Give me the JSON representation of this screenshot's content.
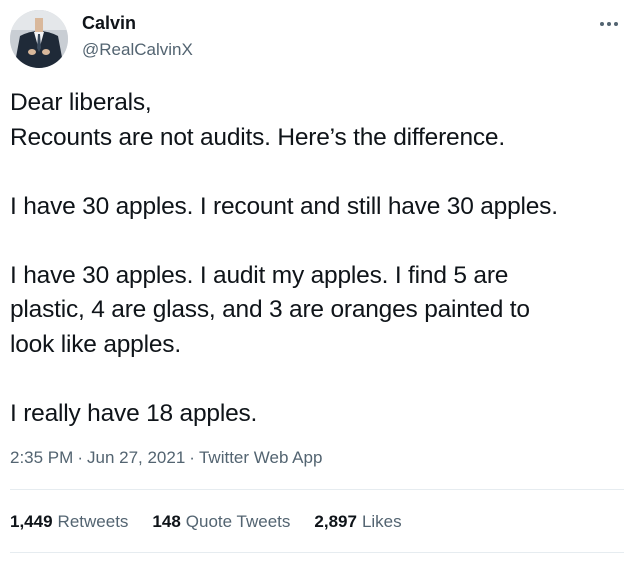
{
  "author": {
    "name": "Calvin",
    "handle": "@RealCalvinX"
  },
  "tweet": {
    "paragraphs": [
      [
        "Dear liberals,",
        "Recounts are not audits. Here’s the difference."
      ],
      [
        "I have 30 apples. I recount and still have 30 apples."
      ],
      [
        "I have 30 apples. I audit my apples. I find 5 are",
        "plastic, 4 are glass, and 3 are oranges painted to",
        "look like apples."
      ],
      [
        "I really have 18 apples."
      ]
    ],
    "time": "2:35 PM",
    "date": "Jun 27, 2021",
    "source": "Twitter Web App",
    "separator": "·"
  },
  "stats": {
    "retweets_count": "1,449",
    "retweets_label": "Retweets",
    "quotes_count": "148",
    "quotes_label": "Quote Tweets",
    "likes_count": "2,897",
    "likes_label": "Likes"
  },
  "icons": {
    "more": "more-horizontal-icon"
  },
  "colors": {
    "text": "#0f1419",
    "secondary": "#536471",
    "divider": "#e6ecf0"
  }
}
